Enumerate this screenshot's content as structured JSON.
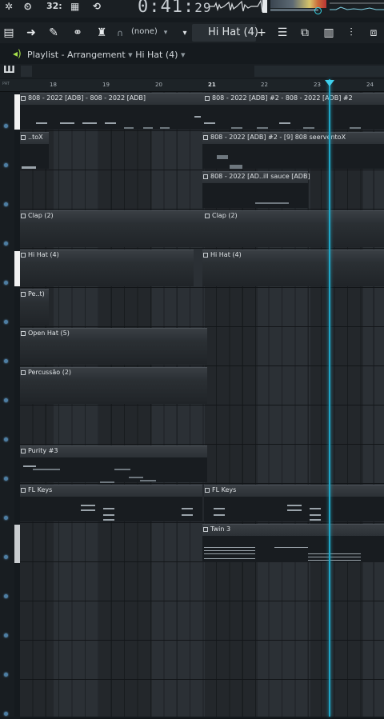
{
  "transport": {
    "time": "0:41:",
    "time_sub": "29",
    "tempo_label": "32:"
  },
  "toolbar": {
    "snap": "(none)",
    "pattern": "Hi Hat (4)",
    "plus": "+"
  },
  "window": {
    "title": "Playlist - Arrangement",
    "separator": "›",
    "current_pattern": "Hi Hat (4)"
  },
  "ruler": {
    "bars": [
      "18",
      "19",
      "20",
      "21",
      "22",
      "23",
      "24"
    ],
    "corner": "PAT"
  },
  "clips": [
    {
      "label": "808 - 2022 [ADB] - 808 - 2022 [ADB]"
    },
    {
      "label": "808 - 2022 [ADB] #2 - 808 - 2022 [ADB] #2"
    },
    {
      "label": "..toX"
    },
    {
      "label": "808 - 2022 [ADB] #2 - [9] 808 seerventoX"
    },
    {
      "label": "808 - 2022 [AD..ill sauce [ADB]"
    },
    {
      "label": "Clap (2)"
    },
    {
      "label": "Clap (2)"
    },
    {
      "label": "Hi Hat (4)"
    },
    {
      "label": "Hi Hat (4)"
    },
    {
      "label": "Pe..t)"
    },
    {
      "label": "Open Hat (5)"
    },
    {
      "label": "Percussão (2)"
    },
    {
      "label": "Purity #3"
    },
    {
      "label": "FL Keys"
    },
    {
      "label": "FL Keys"
    },
    {
      "label": "Twin 3"
    }
  ],
  "colors": {
    "playhead": "#1fa6c6",
    "background": "#151a1e",
    "grid": "#2b3035"
  }
}
